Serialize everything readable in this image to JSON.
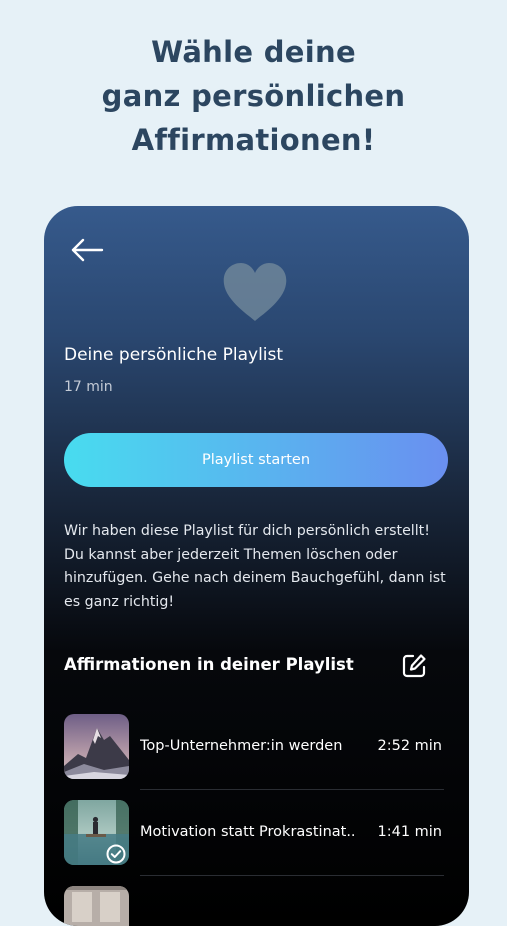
{
  "promo": {
    "headline_lines": [
      "Wähle deine",
      "ganz persönlichen",
      "Affirmationen!"
    ]
  },
  "playlist": {
    "title": "Deine persönliche Playlist",
    "duration": "17 min",
    "start_label": "Playlist starten",
    "description": "Wir haben diese Playlist für dich persönlich erstellt! Du kannst aber jederzeit Themen löschen oder hinzufügen. Gehe nach deinem Bauchgefühl, dann ist es ganz richtig!"
  },
  "section": {
    "title": "Affirmationen in deiner Playlist"
  },
  "items": [
    {
      "title": "Top-Unternehmer:in werden",
      "time": "2:52 min",
      "thumb": "mountain-image",
      "checked": false
    },
    {
      "title": "Motivation statt Prokrastinat..",
      "time": "1:41 min",
      "thumb": "lake-person-image",
      "checked": true
    },
    {
      "title": "",
      "time": "",
      "thumb": "room-image",
      "checked": false
    }
  ],
  "icons": {
    "back": "arrow-left-icon",
    "heart": "heart-icon",
    "edit": "edit-icon",
    "check": "check-circle-icon"
  },
  "colors": {
    "page_background": "#e6f1f7",
    "headline": "#2c4660",
    "card_top": "#365a8c",
    "card_bottom": "#000000",
    "button_start": "#48dcef",
    "button_end": "#6a8ff0"
  }
}
